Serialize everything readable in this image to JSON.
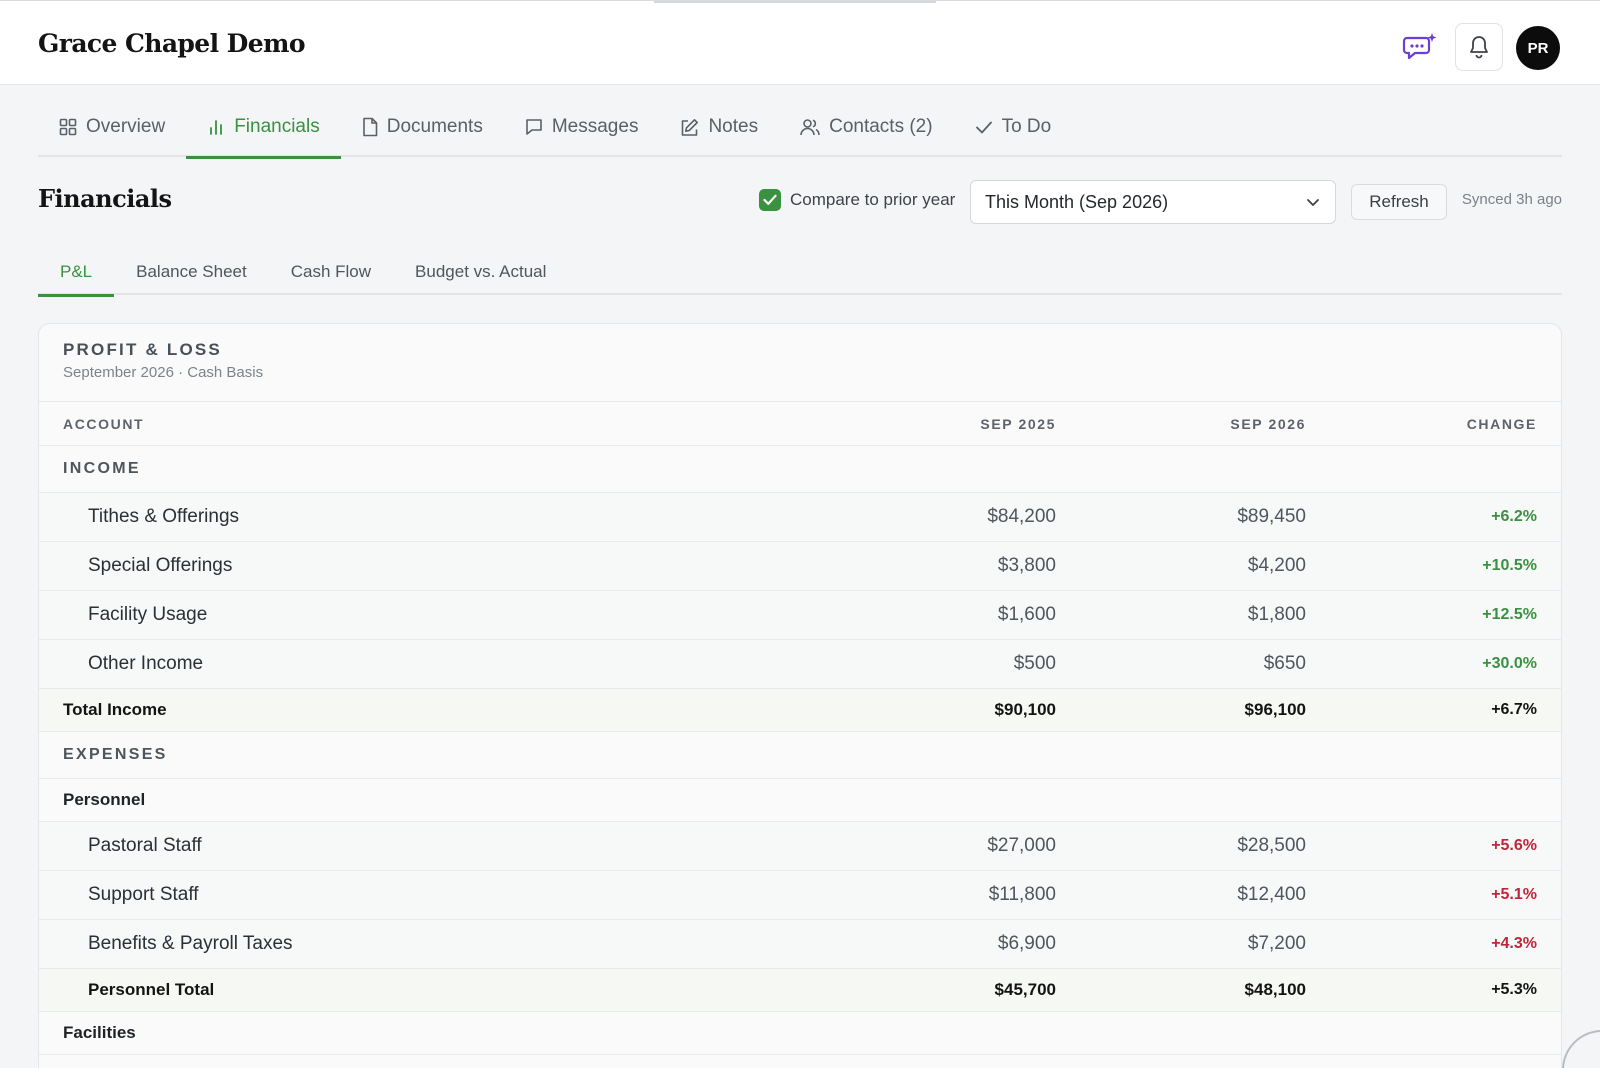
{
  "header": {
    "org_title": "Grace Chapel Demo",
    "avatar_initials": "PR",
    "icons": [
      "ai-chat-icon",
      "bell-icon"
    ]
  },
  "main_tabs": [
    {
      "label": "Overview",
      "icon": "grid-icon",
      "active": false
    },
    {
      "label": "Financials",
      "icon": "bar-chart-icon",
      "active": true
    },
    {
      "label": "Documents",
      "icon": "document-icon",
      "active": false
    },
    {
      "label": "Messages",
      "icon": "message-icon",
      "active": false
    },
    {
      "label": "Notes",
      "icon": "edit-icon",
      "active": false
    },
    {
      "label": "Contacts (2)",
      "icon": "contacts-icon",
      "active": false
    },
    {
      "label": "To Do",
      "icon": "check-icon",
      "active": false
    }
  ],
  "financials": {
    "title": "Financials",
    "compare_label": "Compare to prior year",
    "compare_checked": true,
    "period_selected": "This Month (Sep 2026)",
    "refresh_label": "Refresh",
    "synced_text": "Synced 3h ago"
  },
  "sub_tabs": [
    {
      "label": "P&L",
      "active": true
    },
    {
      "label": "Balance Sheet",
      "active": false
    },
    {
      "label": "Cash Flow",
      "active": false
    },
    {
      "label": "Budget vs. Actual",
      "active": false
    }
  ],
  "report": {
    "title": "PROFIT & LOSS",
    "subtitle": "September 2026 · Cash Basis",
    "columns": {
      "account": "ACCOUNT",
      "prev": "SEP 2025",
      "curr": "SEP 2026",
      "change": "CHANGE"
    },
    "rows": [
      {
        "type": "group",
        "account": "INCOME"
      },
      {
        "type": "line",
        "account": "Tithes & Offerings",
        "prev": "$84,200",
        "curr": "$89,450",
        "change": "+6.2%",
        "tone": "pos"
      },
      {
        "type": "line",
        "account": "Special Offerings",
        "prev": "$3,800",
        "curr": "$4,200",
        "change": "+10.5%",
        "tone": "pos"
      },
      {
        "type": "line",
        "account": "Facility Usage",
        "prev": "$1,600",
        "curr": "$1,800",
        "change": "+12.5%",
        "tone": "pos"
      },
      {
        "type": "line",
        "account": "Other Income",
        "prev": "$500",
        "curr": "$650",
        "change": "+30.0%",
        "tone": "pos"
      },
      {
        "type": "total",
        "account": "Total Income",
        "prev": "$90,100",
        "curr": "$96,100",
        "change": "+6.7%",
        "tone": "pos"
      },
      {
        "type": "group",
        "account": "EXPENSES"
      },
      {
        "type": "subgroup",
        "account": "Personnel"
      },
      {
        "type": "line",
        "account": "Pastoral Staff",
        "prev": "$27,000",
        "curr": "$28,500",
        "change": "+5.6%",
        "tone": "neg"
      },
      {
        "type": "line",
        "account": "Support Staff",
        "prev": "$11,800",
        "curr": "$12,400",
        "change": "+5.1%",
        "tone": "neg"
      },
      {
        "type": "line",
        "account": "Benefits & Payroll Taxes",
        "prev": "$6,900",
        "curr": "$7,200",
        "change": "+4.3%",
        "tone": "neg"
      },
      {
        "type": "subtotal",
        "account": "Personnel Total",
        "prev": "$45,700",
        "curr": "$48,100",
        "change": "+5.3%",
        "tone": "neg"
      },
      {
        "type": "subgroup",
        "account": "Facilities"
      }
    ]
  },
  "colors": {
    "accent_green": "#3a9140",
    "negative_red": "#c0263a",
    "ai_purple": "#6b3fd6"
  }
}
